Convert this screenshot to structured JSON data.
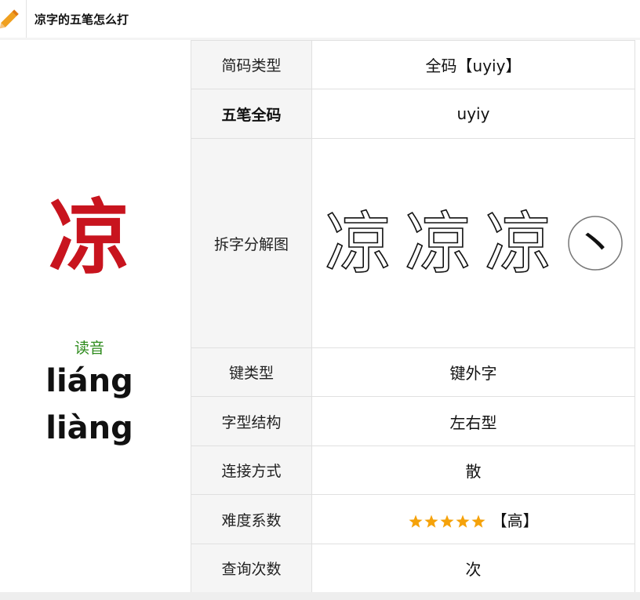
{
  "header": {
    "title": "凉字的五笔怎么打",
    "icon": "pencil-icon",
    "icon_color": "#f0a020"
  },
  "character": {
    "glyph": "凉",
    "color": "#c8141e"
  },
  "reading": {
    "label": "读音",
    "pinyin": [
      "liáng",
      "liàng"
    ],
    "label_color": "#2e8b1d"
  },
  "rows": [
    {
      "key": "简码类型",
      "value": "全码【uyiy】"
    },
    {
      "key": "五笔全码",
      "value": "uyiy"
    },
    {
      "key": "拆字分解图",
      "value_glyphs": [
        "凉",
        "凉",
        "凉"
      ],
      "stroke_glyph": "丶"
    },
    {
      "key": "键类型",
      "value": "键外字"
    },
    {
      "key": "字型结构",
      "value": "左右型"
    },
    {
      "key": "连接方式",
      "value": "散"
    },
    {
      "key": "难度系数",
      "value": "【高】",
      "stars": 5,
      "star_color": "#f5a20a"
    },
    {
      "key": "查询次数",
      "value": "次"
    }
  ]
}
